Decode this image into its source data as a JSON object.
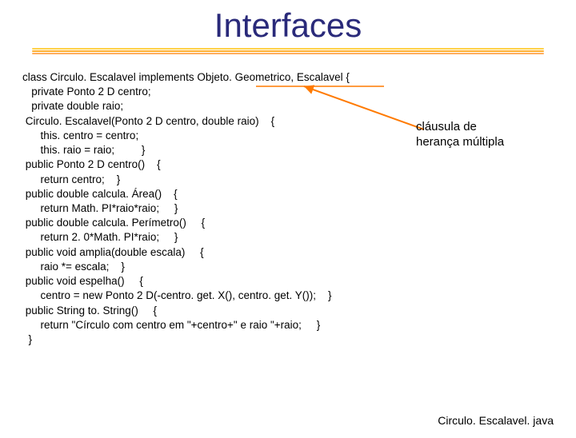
{
  "title": "Interfaces",
  "code_lines": [
    "class Circulo. Escalavel implements Objeto. Geometrico, Escalavel {",
    "   private Ponto 2 D centro;",
    "   private double raio;",
    " Circulo. Escalavel(Ponto 2 D centro, double raio)    {",
    "      this. centro = centro;",
    "      this. raio = raio;         }",
    " public Ponto 2 D centro()    {",
    "      return centro;    }",
    " public double calcula. Área()    {",
    "      return Math. PI*raio*raio;     }",
    " public double calcula. Perímetro()     {",
    "      return 2. 0*Math. PI*raio;     }",
    " public void amplia(double escala)     {",
    "      raio *= escala;    }",
    " public void espelha()     {",
    "      centro = new Ponto 2 D(-centro. get. X(), centro. get. Y());    }",
    " public String to. String()     {",
    "      return \"Círculo com centro em \"+centro+\" e raio \"+raio;     }",
    "  }"
  ],
  "annotation_line1": "cláusula de",
  "annotation_line2": "herança múltipla",
  "filename": "Circulo. Escalavel. java",
  "arrow_color": "#ff7a00"
}
